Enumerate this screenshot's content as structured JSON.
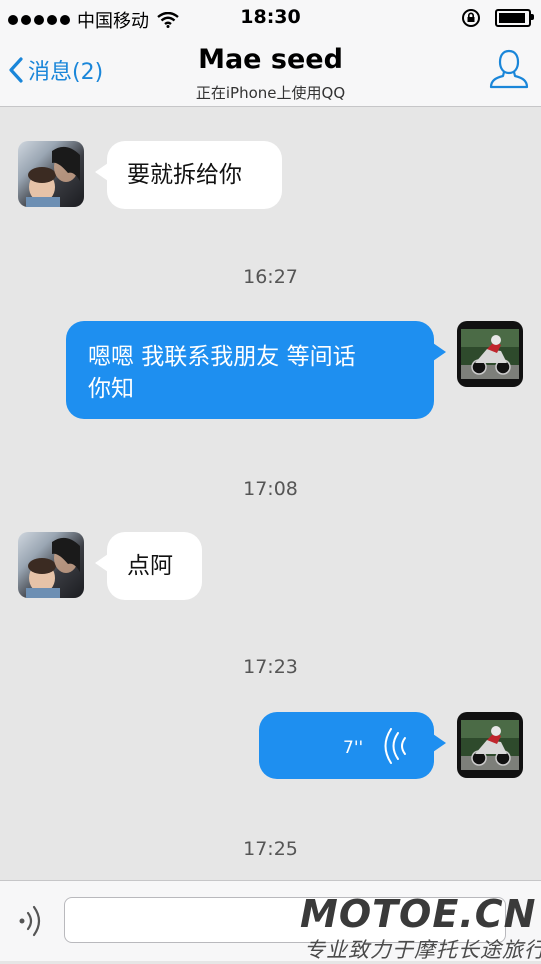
{
  "status_bar": {
    "carrier": "中国移动",
    "time": "18:30"
  },
  "nav": {
    "back_label": "消息(2)",
    "title": "Mae seed",
    "subtitle": "正在iPhone上使用QQ"
  },
  "messages": [
    {
      "direction": "incoming",
      "type": "text",
      "text": "要就拆给你"
    },
    {
      "type": "timestamp",
      "text": "16:27"
    },
    {
      "direction": "outgoing",
      "type": "text",
      "lines": [
        "嗯嗯 我联系我朋友 等间话",
        "你知"
      ]
    },
    {
      "type": "timestamp",
      "text": "17:08"
    },
    {
      "direction": "incoming",
      "type": "text",
      "text": "点阿"
    },
    {
      "type": "timestamp",
      "text": "17:23"
    },
    {
      "direction": "outgoing",
      "type": "voice",
      "duration": "7''"
    },
    {
      "type": "timestamp",
      "text": "17:25"
    }
  ],
  "input": {
    "placeholder": "",
    "value": ""
  },
  "watermark": {
    "logo_text": "MOTOE.CN",
    "tagline": "专业致力于摩托长途旅行"
  },
  "colors": {
    "accent": "#1a86d9",
    "outgoing_bubble": "#1e8ff0",
    "incoming_bubble": "#ffffff",
    "chat_background": "#e6e6e6"
  },
  "icons": [
    "signal-dots-icon",
    "wifi-icon",
    "rotation-lock-icon",
    "battery-icon",
    "back-chevron-icon",
    "profile-icon",
    "voice-waves-icon",
    "voice-input-icon"
  ]
}
